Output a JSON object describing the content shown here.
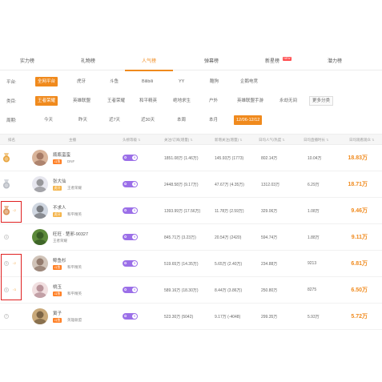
{
  "tabs": [
    {
      "label": "实力榜",
      "active": false
    },
    {
      "label": "礼物榜",
      "active": false
    },
    {
      "label": "人气榜",
      "active": true
    },
    {
      "label": "弹幕榜",
      "active": false
    },
    {
      "label": "新星榜",
      "active": false,
      "badge": "NEW"
    },
    {
      "label": "潜力榜",
      "active": false
    }
  ],
  "filters": {
    "platform": {
      "label": "平台:",
      "options": [
        "全网平台",
        "虎牙",
        "斗鱼",
        "Bilibili",
        "YY",
        "酷狗",
        "企鹅电竞"
      ],
      "selected": 0
    },
    "category": {
      "label": "类目:",
      "options": [
        "王者荣耀",
        "英雄联盟",
        "王者荣耀",
        "和平精英",
        "绝地求生",
        "户外",
        "英雄联盟手游",
        "永劫无间",
        "更多分类"
      ],
      "selected": 0
    },
    "period": {
      "label": "周期:",
      "options": [
        "今天",
        "昨天",
        "近7天",
        "近30天",
        "本周",
        "本月",
        "12/06-12/12"
      ],
      "selected": 6
    }
  },
  "table": {
    "headers": [
      "排名",
      "主播",
      "头榜等级",
      "关注/订阅(增量)",
      "新增关注(增量)",
      "日均人气/热度",
      "日均直播时长",
      "日均观看观众"
    ],
    "rows": [
      {
        "rank": 1,
        "trend": "",
        "name": "瓶瓶蛮蛮",
        "tag": "斗鱼",
        "game": "DNF",
        "level": "9",
        "followers": "1851.08万 (1.46万)",
        "new": "145.93万 (1773)",
        "pop": "802.14万",
        "hours": "10.04万",
        "hot": "18.83万"
      },
      {
        "rank": 2,
        "trend": "",
        "name": "张大仙",
        "tag": "虎牙",
        "game": "王者荣耀",
        "level": "9",
        "followers": "2448.58万 (9.17万)",
        "new": "47.67万 (4.35万)",
        "pop": "1312.03万",
        "hours": "6.29万",
        "hot": "18.71万"
      },
      {
        "rank": 3,
        "trend": "↑2",
        "name": "不求人",
        "tag": "虎牙",
        "game": "和平精英",
        "level": "9",
        "followers": "1393.99万 (17.56万)",
        "new": "11.78万 (2.59万)",
        "pop": "329.06万",
        "hours": "1.08万",
        "hot": "9.46万"
      },
      {
        "rank": 4,
        "trend": "",
        "name": "旺旺 · 楚邪-90327",
        "tag": "",
        "game": "王者荣耀",
        "level": "9",
        "followers": "845.71万 (3.23万)",
        "new": "20.54万 (2420)",
        "pop": "594.74万",
        "hours": "1.88万",
        "hot": "9.11万"
      },
      {
        "rank": 5,
        "trend": "↑2",
        "name": "鲸鱼杉",
        "tag": "斗鱼",
        "game": "和平精英",
        "level": "9",
        "followers": "519.65万 (14.35万)",
        "new": "5.65万 (2.40万)",
        "pop": "234.88万",
        "hours": "9213",
        "hot": "6.81万"
      },
      {
        "rank": 6,
        "trend": "↑3",
        "name": "桃玉",
        "tag": "斗鱼",
        "game": "和平精英",
        "level": "9",
        "followers": "589.16万 (18.30万)",
        "new": "8.44万 (3.86万)",
        "pop": "250.80万",
        "hours": "8275",
        "hot": "6.50万"
      },
      {
        "rank": 7,
        "trend": "",
        "name": "寅子",
        "tag": "斗鱼",
        "game": "英雄联盟",
        "level": "9",
        "followers": "523.30万 (5042)",
        "new": "9.17万 (-4048)",
        "pop": "299.35万",
        "hours": "5.93万",
        "hot": "5.72万"
      }
    ]
  },
  "colors": {
    "accent": "#f08a1d",
    "level_badge": "#9b6fe8",
    "highlight": "#e02020",
    "tag_douyu": "#ff7f24",
    "tag_huya": "#f4b44a"
  },
  "icons": [
    "gold-medal-icon",
    "silver-medal-icon",
    "bronze-medal-icon",
    "sort-icon",
    "level-badge-icon"
  ]
}
